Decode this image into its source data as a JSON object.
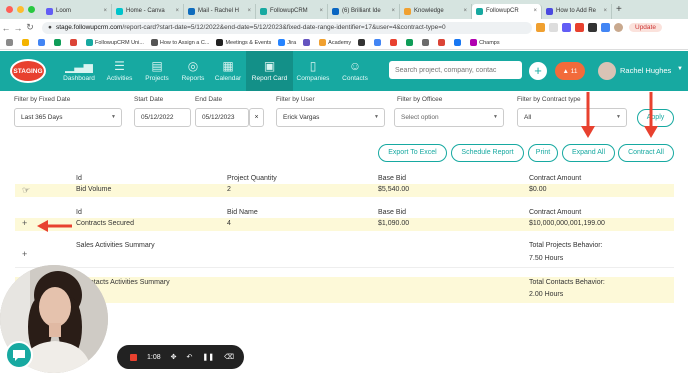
{
  "browser": {
    "tabs": [
      {
        "label": "Loom",
        "color": "#625df5",
        "active": false
      },
      {
        "label": "Home - Canva",
        "color": "#00c4cc",
        "active": false
      },
      {
        "label": "Mail - Rachel H",
        "color": "#0f6cbd",
        "active": false
      },
      {
        "label": "FollowupCRM",
        "color": "#17a9a1",
        "active": false
      },
      {
        "label": "(6) Brilliant Ide",
        "color": "#0a66c2",
        "active": false
      },
      {
        "label": "Knowledge",
        "color": "#f0a030",
        "active": false
      },
      {
        "label": "FollowupCR",
        "color": "#17a9a1",
        "active": true
      },
      {
        "label": "How to Add Re",
        "color": "#4a4ae0",
        "active": false
      }
    ],
    "url_host": "stage.followupcrm.com",
    "url_path": "/report-card?start-date=5/12/2022&end-date=5/12/2023&fixed-date-range-identifier=17&user=4&contract-type=0",
    "update_label": "Update",
    "bookmarks": [
      {
        "label": "",
        "color": "#8a8a8a"
      },
      {
        "label": "",
        "color": "#f4b400"
      },
      {
        "label": "",
        "color": "#4285f4"
      },
      {
        "label": "",
        "color": "#0f9d58"
      },
      {
        "label": "",
        "color": "#db4437"
      },
      {
        "label": "FollowupCRM Uni...",
        "color": "#17a9a1"
      },
      {
        "label": "How to Assign a C...",
        "color": "#555555"
      },
      {
        "label": "Meetings & Events",
        "color": "#222222"
      },
      {
        "label": "Jira",
        "color": "#2684ff"
      },
      {
        "label": "",
        "color": "#6554c0"
      },
      {
        "label": "Academy",
        "color": "#f0a030"
      },
      {
        "label": "",
        "color": "#333333"
      },
      {
        "label": "",
        "color": "#4285f4"
      },
      {
        "label": "",
        "color": "#e8412f"
      },
      {
        "label": "",
        "color": "#0f9d58"
      },
      {
        "label": "",
        "color": "#6b6b6b"
      },
      {
        "label": "",
        "color": "#db4437"
      },
      {
        "label": "",
        "color": "#1877f2"
      },
      {
        "label": "Champs",
        "color": "#b000b0"
      }
    ]
  },
  "app": {
    "staging_label": "STAGING",
    "nav": [
      {
        "label": "Dashboard",
        "icon": "bar-chart-icon"
      },
      {
        "label": "Activities",
        "icon": "list-icon"
      },
      {
        "label": "Projects",
        "icon": "folder-icon"
      },
      {
        "label": "Reports",
        "icon": "target-icon"
      },
      {
        "label": "Calendar",
        "icon": "calendar-icon"
      },
      {
        "label": "Report Card",
        "icon": "report-card-icon",
        "active": true
      },
      {
        "label": "Companies",
        "icon": "building-icon"
      },
      {
        "label": "Contacts",
        "icon": "contacts-icon"
      }
    ],
    "search_placeholder": "Search project, company, contac",
    "notification_count": "11",
    "user_name": "Rachel Hughes",
    "accent_color": "#17a9a1"
  },
  "filters": {
    "fixed_date_label": "Filter by Fixed Date",
    "fixed_date_value": "Last 365 Days",
    "start_date_label": "Start Date",
    "start_date_value": "05/12/2022",
    "end_date_label": "End Date",
    "end_date_value": "05/12/2023",
    "user_label": "Filter by User",
    "user_value": "Erick Vargas",
    "officee_label": "Filter by Officee",
    "officee_placeholder": "Select option",
    "contract_type_label": "Filter by Contract type",
    "contract_type_value": "All",
    "apply_label": "Apply"
  },
  "actions": {
    "export": "Export To Excel",
    "schedule": "Schedule Report",
    "print": "Print",
    "expand": "Expand All",
    "contract": "Contract All"
  },
  "table1": {
    "headers": [
      "Id",
      "Project Quantity",
      "Base Bid",
      "Contract Amount"
    ],
    "row": [
      "Bid Volume",
      "2",
      "$5,540.00",
      "$0.00"
    ]
  },
  "table2": {
    "headers": [
      "Id",
      "Bid Name",
      "Base Bid",
      "Contract Amount"
    ],
    "toggle": "+",
    "row": [
      "Contracts Secured",
      "4",
      "$1,090.00",
      "$10,000,000,001,199.00"
    ]
  },
  "sales_summary": {
    "toggle": "+",
    "title": "Sales Activities Summary",
    "behavior_label": "Total Projects Behavior:",
    "behavior_value": "7.50 Hours"
  },
  "contacts_summary": {
    "title": "ontacts Activities Summary",
    "behavior_label": "Total Contacts Behavior:",
    "behavior_value": "2.00 Hours"
  },
  "recorder": {
    "time": "1:08"
  },
  "annotation_color": "#e8412f"
}
